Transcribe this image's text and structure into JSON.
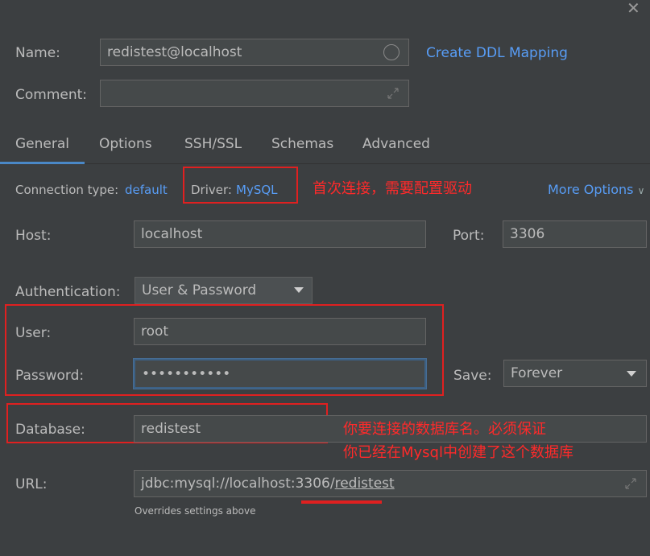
{
  "window": {
    "close_glyph": "✕"
  },
  "name_field": {
    "label": "Name:",
    "value": "redistest@localhost"
  },
  "create_ddl_link": "Create DDL Mapping",
  "comment_field": {
    "label": "Comment:",
    "value": ""
  },
  "tabs": [
    {
      "label": "General",
      "active": true
    },
    {
      "label": "Options",
      "active": false
    },
    {
      "label": "SSH/SSL",
      "active": false
    },
    {
      "label": "Schemas",
      "active": false
    },
    {
      "label": "Advanced",
      "active": false
    }
  ],
  "connection": {
    "type_label": "Connection type:",
    "type_value": "default",
    "driver_label": "Driver:",
    "driver_value": "MySQL",
    "more_options": "More Options"
  },
  "host": {
    "label": "Host:",
    "value": "localhost"
  },
  "port": {
    "label": "Port:",
    "value": "3306"
  },
  "auth": {
    "label": "Authentication:",
    "value": "User & Password"
  },
  "user": {
    "label": "User:",
    "value": "root"
  },
  "password": {
    "label": "Password:",
    "value": "•••••••••••"
  },
  "save": {
    "label": "Save:",
    "value": "Forever"
  },
  "database": {
    "label": "Database:",
    "value": "redistest"
  },
  "url": {
    "label": "URL:",
    "prefix": "jdbc:mysql://localhost:3306/",
    "db": "redistest",
    "hint": "Overrides settings above"
  },
  "annotations": {
    "driver_note": "首次连接，需要配置驱动",
    "database_note_line1": "你要连接的数据库名。必须保证",
    "database_note_line2": "你已经在Mysql中创建了这个数据库"
  },
  "colors": {
    "background": "#3c3f41",
    "link": "#589df6",
    "annotation": "#e02020",
    "tab_underline": "#4a88c7"
  }
}
